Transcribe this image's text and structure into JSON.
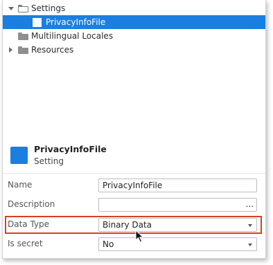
{
  "tree": {
    "items": [
      {
        "label": "Settings",
        "expanded": true,
        "icon": "folder-open-icon"
      },
      {
        "label": "PrivacyInfoFile",
        "selected": true,
        "icon": "setting-icon"
      },
      {
        "label": "Multilingual Locales",
        "icon": "folder-icon"
      },
      {
        "label": "Resources",
        "expanded": false,
        "icon": "folder-icon"
      }
    ]
  },
  "details": {
    "title": "PrivacyInfoFile",
    "subtitle": "Setting"
  },
  "properties": {
    "name": {
      "label": "Name",
      "value": "PrivacyInfoFile"
    },
    "description": {
      "label": "Description",
      "value": "",
      "button": "..."
    },
    "data_type": {
      "label": "Data Type",
      "value": "Binary Data"
    },
    "is_secret": {
      "label": "Is secret",
      "value": "No"
    }
  },
  "colors": {
    "selection": "#1a7fe0",
    "highlight_border": "#d9401e"
  }
}
